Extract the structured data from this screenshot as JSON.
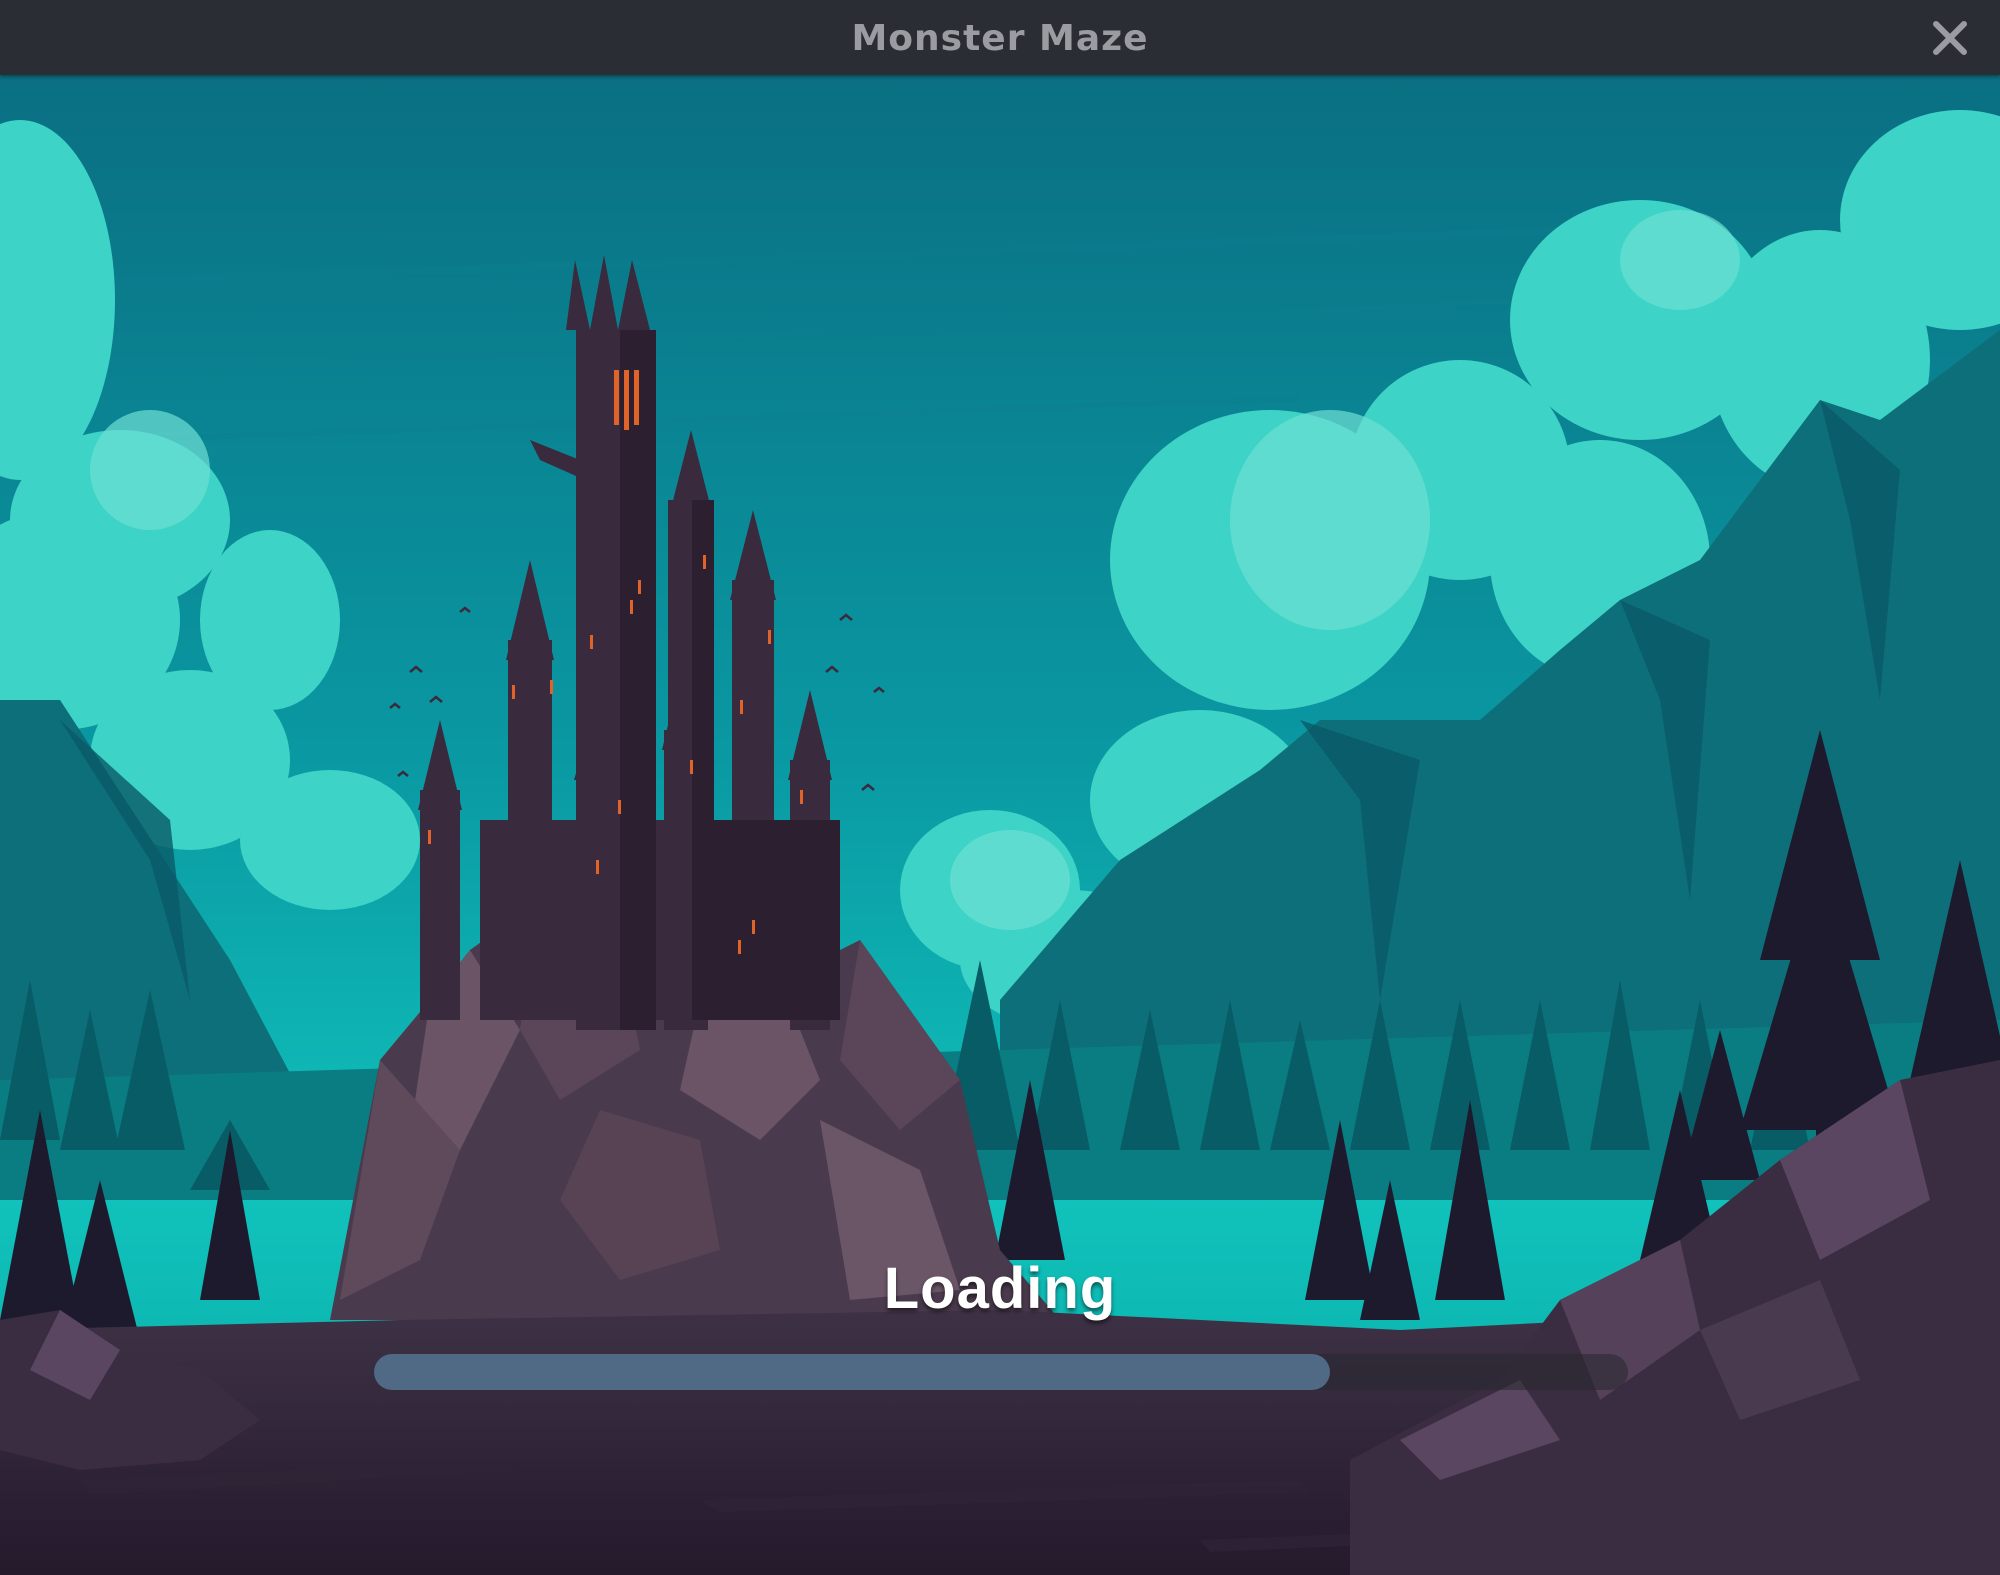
{
  "window": {
    "title": "Monster Maze",
    "close_icon": "close-icon"
  },
  "loading": {
    "label": "Loading",
    "progress": 0.762
  },
  "colors": {
    "titlebar": "#2a2d33",
    "title_text": "#9a9ca1",
    "progress_fill": "#506984",
    "progress_track": "#28282e",
    "sky": "#0aa6a8",
    "castle": "#3a2a3e"
  }
}
